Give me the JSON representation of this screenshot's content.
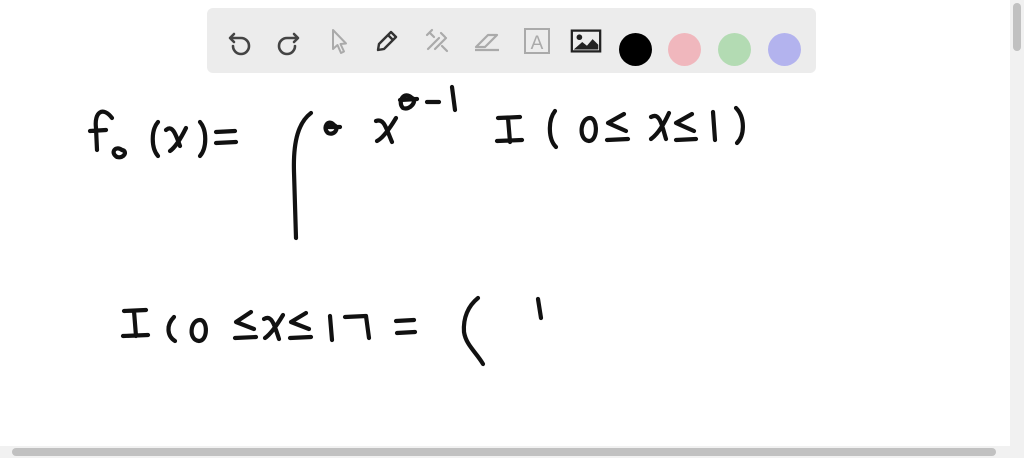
{
  "toolbar": {
    "tools": [
      {
        "id": "undo",
        "icon": "undo-icon"
      },
      {
        "id": "redo",
        "icon": "redo-icon"
      },
      {
        "id": "select",
        "icon": "pointer-icon"
      },
      {
        "id": "pen",
        "icon": "pencil-icon"
      },
      {
        "id": "tools",
        "icon": "wrench-hammer-icon"
      },
      {
        "id": "eraser",
        "icon": "eraser-icon"
      },
      {
        "id": "text",
        "icon": "text-box-icon",
        "glyph": "A"
      },
      {
        "id": "image",
        "icon": "image-icon"
      }
    ],
    "colors": [
      {
        "id": "black",
        "hex": "#000000"
      },
      {
        "id": "red",
        "hex": "#f0b7bd"
      },
      {
        "id": "green",
        "hex": "#b3dbb3"
      },
      {
        "id": "blue",
        "hex": "#b3b3ee"
      }
    ]
  }
}
